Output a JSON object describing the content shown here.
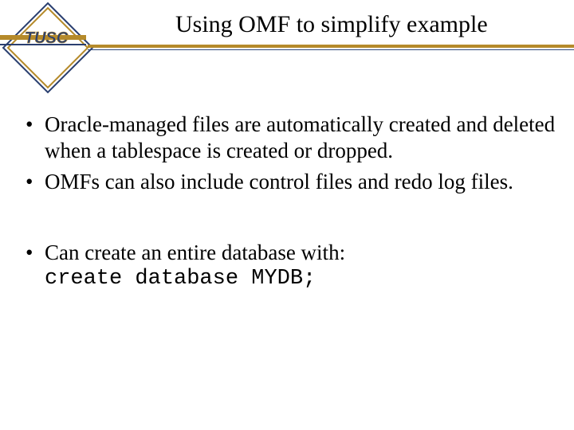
{
  "logo": {
    "text": "TUSC"
  },
  "title": "Using OMF to simplify example",
  "bullets_group1": [
    "Oracle-managed files are automatically created and deleted when a tablespace is created or dropped.",
    "OMFs can also include control files and redo log files."
  ],
  "bullets_group2": [
    {
      "text": "Can create an entire database with:",
      "code": "create database MYDB;"
    }
  ]
}
